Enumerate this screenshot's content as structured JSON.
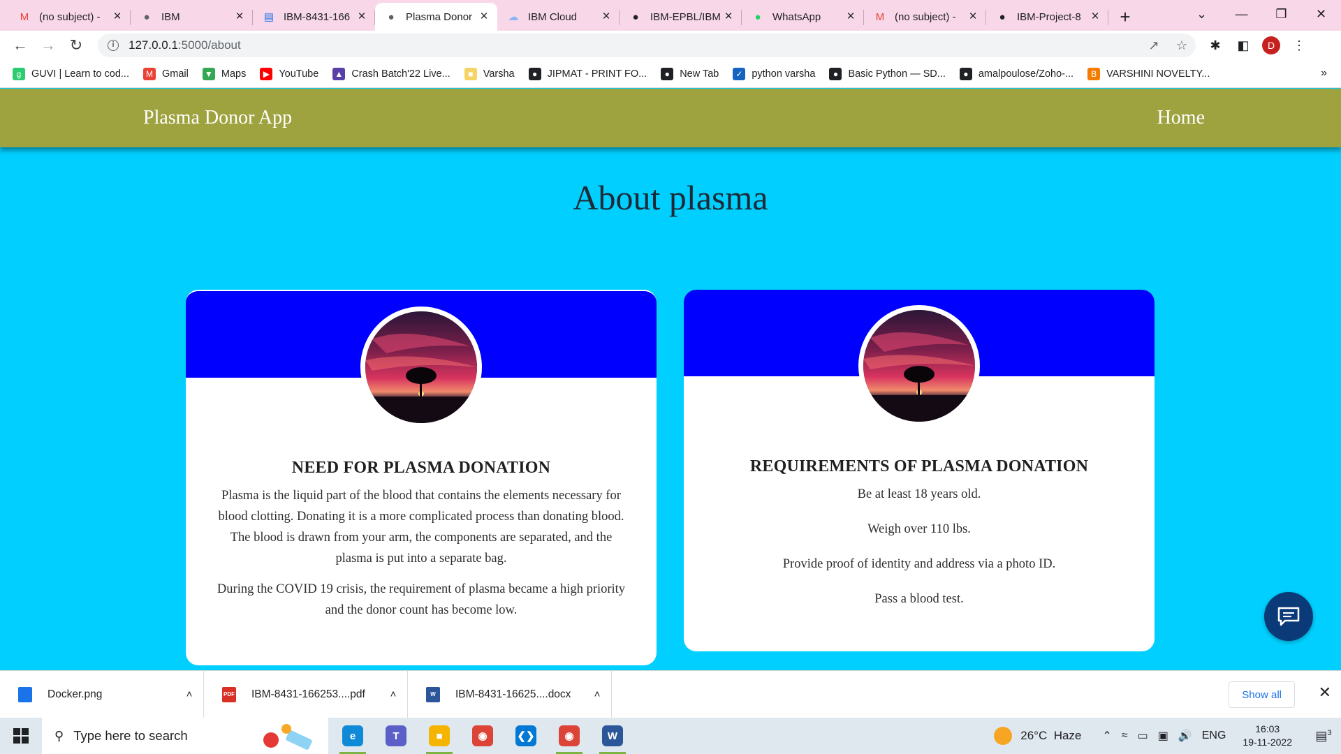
{
  "browser": {
    "tabs": [
      {
        "title": "(no subject) - ",
        "icon": "gmail-icon",
        "color": "#ea4335"
      },
      {
        "title": "IBM",
        "icon": "globe-icon",
        "color": "#5f6368"
      },
      {
        "title": "IBM-8431-166",
        "icon": "doc-icon",
        "color": "#1a73e8"
      },
      {
        "title": "Plasma Donor",
        "icon": "globe-icon",
        "color": "#5f6368",
        "active": true
      },
      {
        "title": "IBM Cloud",
        "icon": "cloud-icon",
        "color": "#8ab4f8"
      },
      {
        "title": "IBM-EPBL/IBM",
        "icon": "github-icon",
        "color": "#202124"
      },
      {
        "title": "WhatsApp",
        "icon": "whatsapp-icon",
        "color": "#25d366"
      },
      {
        "title": "(no subject) - ",
        "icon": "gmail-icon",
        "color": "#ea4335"
      },
      {
        "title": "IBM-Project-8",
        "icon": "github-icon",
        "color": "#202124"
      }
    ],
    "url_host": "127.0.0.1",
    "url_path": ":5000/about",
    "profile_initial": "D",
    "bookmarks": [
      {
        "label": "GUVI | Learn to cod...",
        "icon": "guvi-icon",
        "color": "#2ecc71"
      },
      {
        "label": "Gmail",
        "icon": "gmail-icon",
        "color": "#ea4335"
      },
      {
        "label": "Maps",
        "icon": "maps-icon",
        "color": "#34a853"
      },
      {
        "label": "YouTube",
        "icon": "youtube-icon",
        "color": "#ff0000"
      },
      {
        "label": "Crash Batch'22 Live...",
        "icon": "crash-batch-icon",
        "color": "#5b3fa8"
      },
      {
        "label": "Varsha",
        "icon": "folder-icon",
        "color": "#f6d365"
      },
      {
        "label": "JIPMAT - PRINT FO...",
        "icon": "globe-icon",
        "color": "#202124"
      },
      {
        "label": "New Tab",
        "icon": "globe-icon",
        "color": "#202124"
      },
      {
        "label": "python varsha",
        "icon": "bookmark-app-icon",
        "color": "#1565c0"
      },
      {
        "label": "Basic Python — SD...",
        "icon": "globe-icon",
        "color": "#202124"
      },
      {
        "label": "amalpoulose/Zoho-...",
        "icon": "github-icon",
        "color": "#202124"
      },
      {
        "label": "VARSHINI NOVELTY...",
        "icon": "blogger-icon",
        "color": "#f57c00"
      }
    ]
  },
  "app": {
    "brand": "Plasma Donor App",
    "nav_home": "Home",
    "heading": "About plasma",
    "cards": [
      {
        "title": "NEED FOR PLASMA DONATION",
        "paragraphs": [
          "Plasma is the liquid part of the blood that contains the elements necessary for blood clotting. Donating it is a more complicated process than donating blood. The blood is drawn from your arm, the components are separated, and the plasma is put into a separate bag.",
          "During the COVID 19 crisis, the requirement of plasma became a high priority and the donor count has become low."
        ]
      },
      {
        "title": "REQUIREMENTS OF PLASMA DONATION",
        "paragraphs": [
          "Be at least 18 years old.",
          "Weigh over 110 lbs.",
          "Provide proof of identity and address via a photo ID.",
          "Pass a blood test."
        ]
      }
    ],
    "colors": {
      "navbar": "#9ea23f",
      "page_bg": "#00cfff",
      "card_header": "#0000ff",
      "chat_button": "#0a3a78"
    }
  },
  "downloads": {
    "items": [
      {
        "name": "Docker.png",
        "icon": "image-file-icon",
        "color": "#1a73e8"
      },
      {
        "name": "IBM-8431-166253....pdf",
        "icon": "pdf-file-icon",
        "color": "#d93025"
      },
      {
        "name": "IBM-8431-16625....docx",
        "icon": "word-file-icon",
        "color": "#2b579a"
      }
    ],
    "show_all": "Show all"
  },
  "taskbar": {
    "search_placeholder": "Type here to search",
    "apps": [
      {
        "name": "edge",
        "icon": "edge-icon",
        "color": "#0f8ad6",
        "active": true
      },
      {
        "name": "teams",
        "icon": "teams-icon",
        "color": "#5b5fc7"
      },
      {
        "name": "file-explorer",
        "icon": "folder-icon",
        "color": "#f4b400",
        "active": true
      },
      {
        "name": "chrome",
        "icon": "chrome-icon",
        "color": "#db4437"
      },
      {
        "name": "vscode",
        "icon": "vscode-icon",
        "color": "#0078d4"
      },
      {
        "name": "chrome-profile",
        "icon": "chrome-icon",
        "color": "#db4437",
        "active": true
      },
      {
        "name": "word",
        "icon": "word-icon",
        "color": "#2b579a",
        "active": true
      }
    ],
    "weather_temp": "26°C",
    "weather_desc": "Haze",
    "language": "ENG",
    "time": "16:03",
    "date": "19-11-2022",
    "notification_count": "3"
  }
}
